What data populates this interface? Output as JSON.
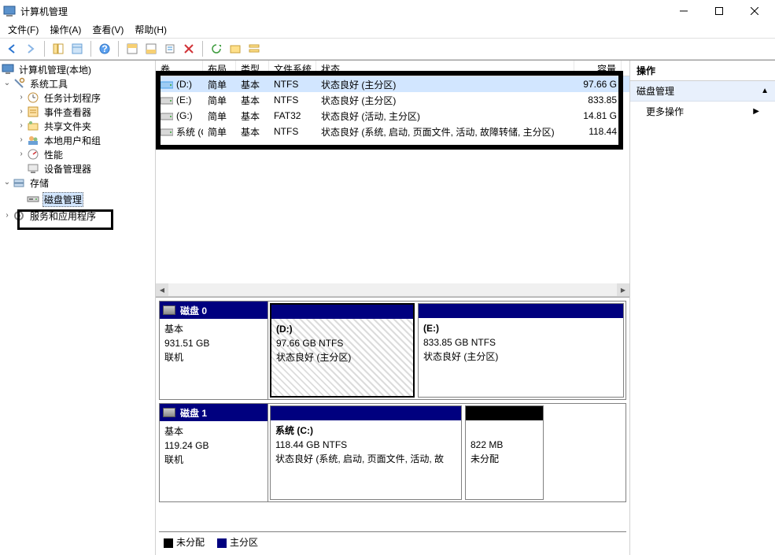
{
  "window": {
    "title": "计算机管理"
  },
  "menu": {
    "file": "文件(F)",
    "action": "操作(A)",
    "view": "查看(V)",
    "help": "帮助(H)"
  },
  "tree": {
    "root": "计算机管理(本地)",
    "systools": "系统工具",
    "tasks": "任务计划程序",
    "events": "事件查看器",
    "shared": "共享文件夹",
    "users": "本地用户和组",
    "perf": "性能",
    "devmgr": "设备管理器",
    "storage": "存储",
    "diskmgmt": "磁盘管理",
    "services": "服务和应用程序"
  },
  "vol_headers": {
    "vol": "卷",
    "layout": "布局",
    "type": "类型",
    "fs": "文件系统",
    "status": "状态",
    "cap": "容量"
  },
  "volumes": [
    {
      "name": "(D:)",
      "layout": "简单",
      "type": "基本",
      "fs": "NTFS",
      "status": "状态良好 (主分区)",
      "cap": "97.66 G",
      "selected": true
    },
    {
      "name": "(E:)",
      "layout": "简单",
      "type": "基本",
      "fs": "NTFS",
      "status": "状态良好 (主分区)",
      "cap": "833.85"
    },
    {
      "name": "(G:)",
      "layout": "简单",
      "type": "基本",
      "fs": "FAT32",
      "status": "状态良好 (活动, 主分区)",
      "cap": "14.81 G"
    },
    {
      "name": "系统 (C:)",
      "layout": "简单",
      "type": "基本",
      "fs": "NTFS",
      "status": "状态良好 (系统, 启动, 页面文件, 活动, 故障转储, 主分区)",
      "cap": "118.44"
    }
  ],
  "disk0": {
    "name": "磁盘 0",
    "type": "基本",
    "size": "931.51 GB",
    "status": "联机",
    "p1": {
      "label": "(D:)",
      "detail": "97.66 GB NTFS",
      "state": "状态良好 (主分区)"
    },
    "p2": {
      "label": "(E:)",
      "detail": "833.85 GB NTFS",
      "state": "状态良好 (主分区)"
    }
  },
  "disk1": {
    "name": "磁盘 1",
    "type": "基本",
    "size": "119.24 GB",
    "status": "联机",
    "p1": {
      "label": "系统  (C:)",
      "detail": "118.44 GB NTFS",
      "state": "状态良好 (系统, 启动, 页面文件, 活动, 故"
    },
    "p2": {
      "label": "",
      "detail": "822 MB",
      "state": "未分配"
    }
  },
  "legend": {
    "unalloc": "未分配",
    "primary": "主分区"
  },
  "actions": {
    "header": "操作",
    "section": "磁盘管理",
    "more": "更多操作"
  }
}
